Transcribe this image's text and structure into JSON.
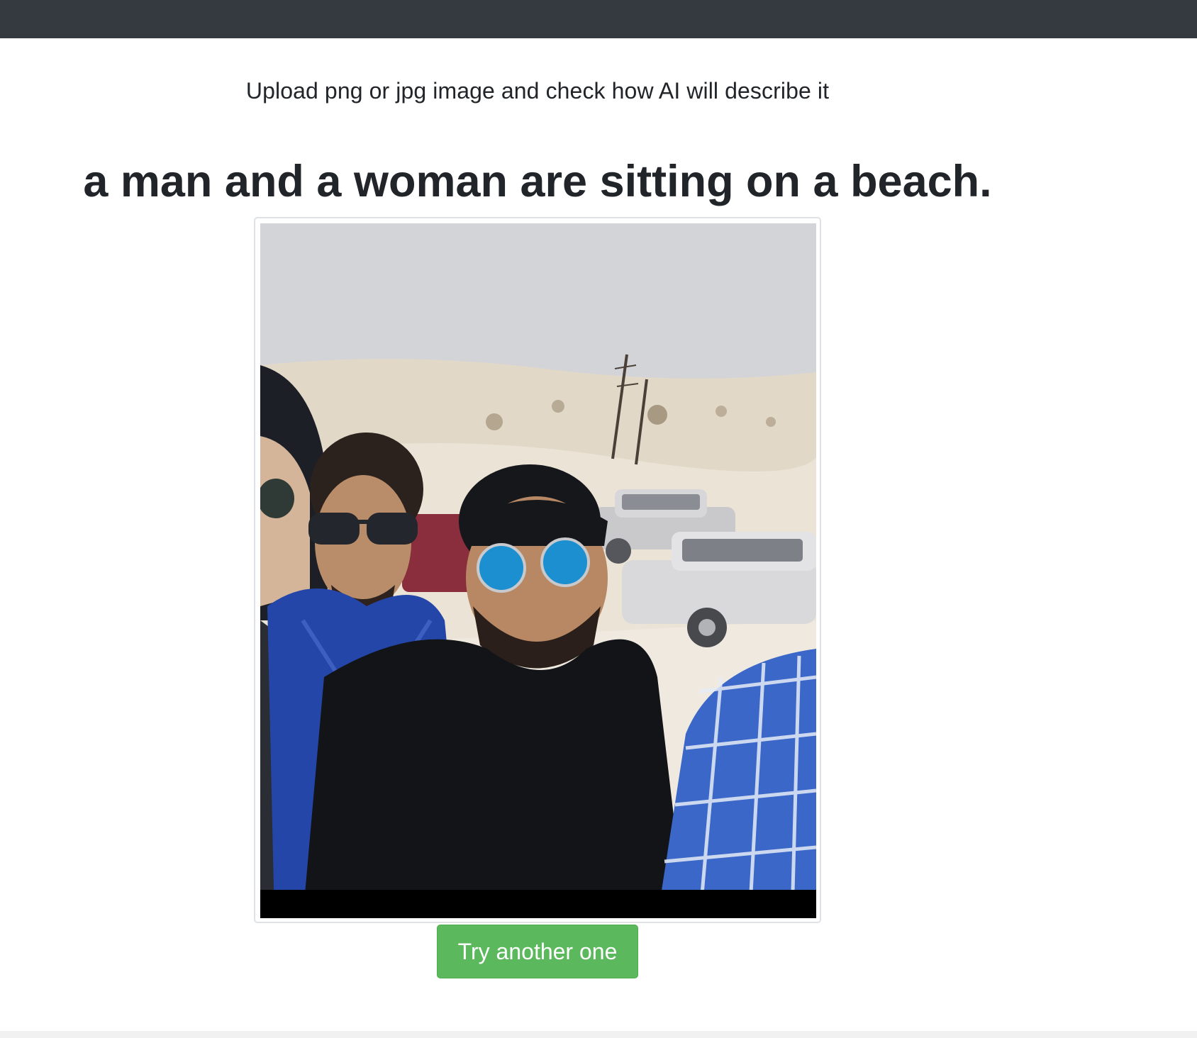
{
  "header": {
    "subtitle": "Upload png or jpg image and check how AI will describe it"
  },
  "result": {
    "caption": "a man and a woman are sitting on a beach.",
    "image_alt": "uploaded photo"
  },
  "actions": {
    "retry_label": "Try another one"
  },
  "colors": {
    "navbar": "#343a40",
    "button": "#5cb85c",
    "text": "#212529"
  }
}
